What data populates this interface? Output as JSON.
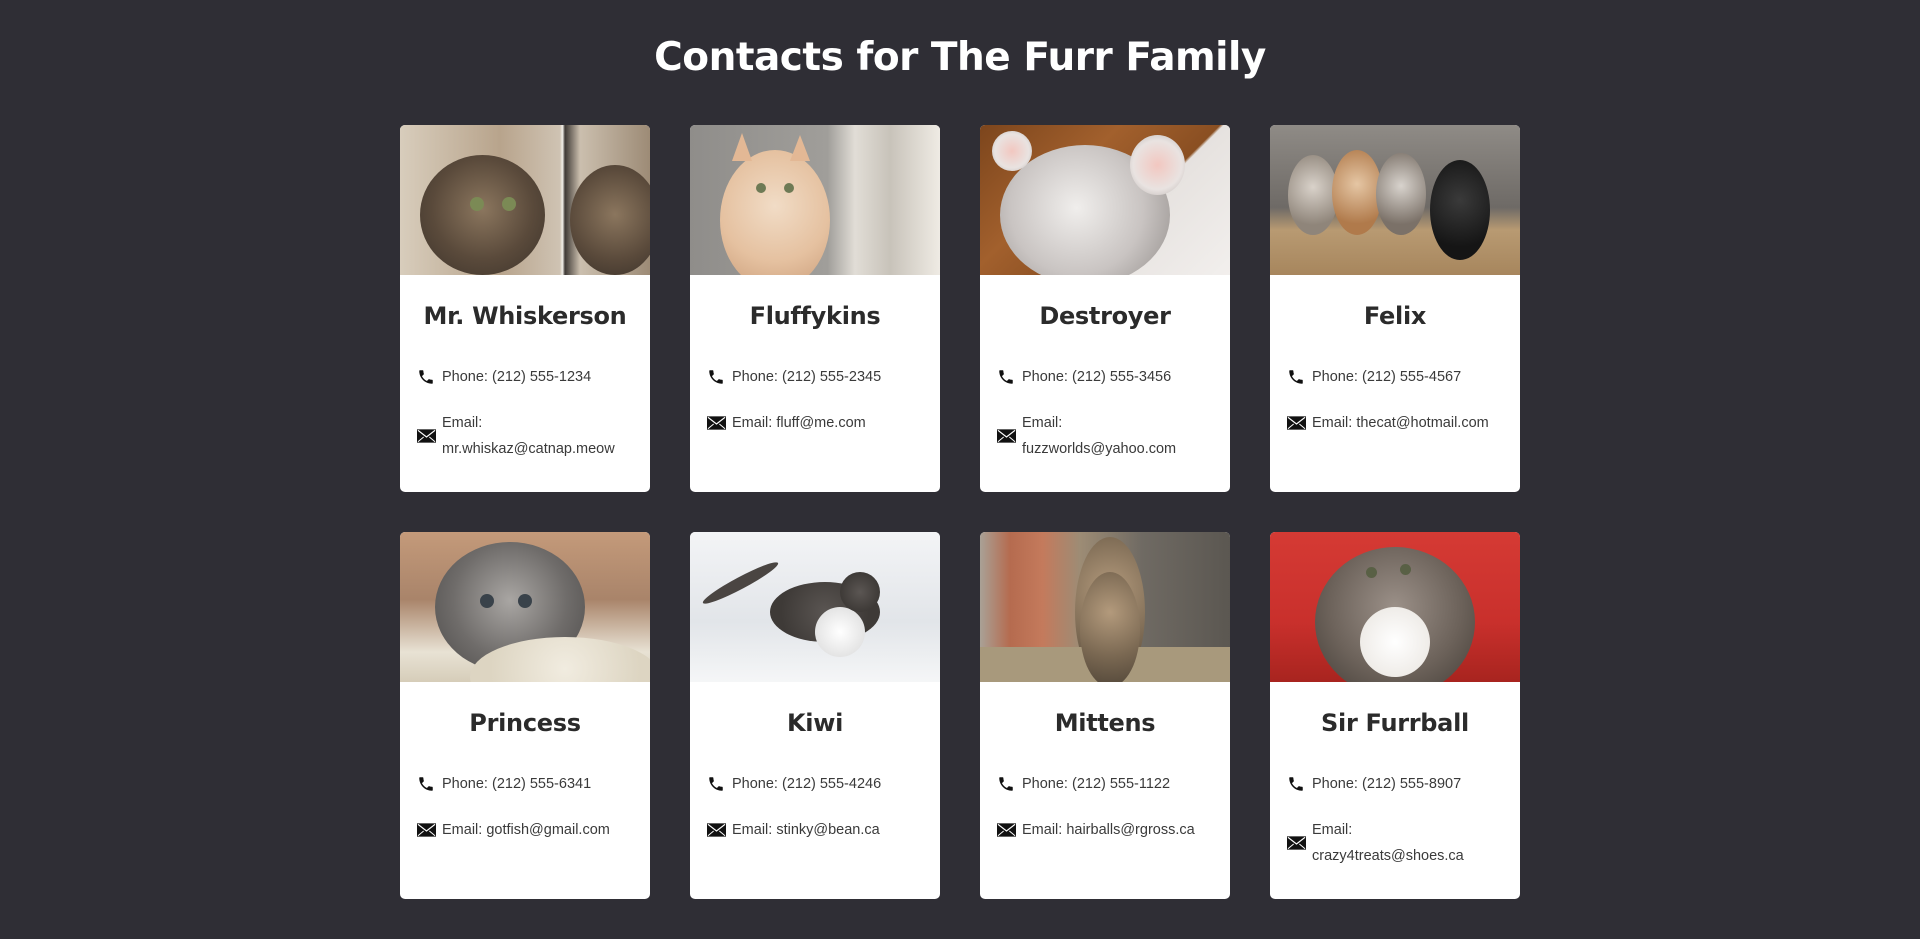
{
  "page": {
    "title": "Contacts for The Furr Family",
    "background": "#2f2e35"
  },
  "icons": {
    "phone": "phone-icon",
    "email": "envelope-icon"
  },
  "contacts": [
    {
      "name": "Mr. Whiskerson",
      "phone_label": "Phone: (212) 555-1234",
      "email_label": "Email:",
      "email": "mr.whiskaz@catnap.meow",
      "photo": "tabby kitten looking at its reflection in a mirror",
      "colors": [
        "#c8b9a6",
        "#6b5a48",
        "#3d342c"
      ]
    },
    {
      "name": "Fluffykins",
      "phone_label": "Phone: (212) 555-2345",
      "email_label": "Email:",
      "email": "fluff@me.com",
      "photo": "cream kitten peeking beside a door frame",
      "colors": [
        "#9a9896",
        "#e2c3a8",
        "#d9d4cc"
      ]
    },
    {
      "name": "Destroyer",
      "phone_label": "Phone: (212) 555-3456",
      "email_label": "Email:",
      "email": "fuzzworlds@yahoo.com",
      "photo": "grey kitten lying on its back with paws up",
      "colors": [
        "#8a4f22",
        "#c9c4c2",
        "#e9e4e2"
      ]
    },
    {
      "name": "Felix",
      "phone_label": "Phone: (212) 555-4567",
      "email_label": "Email:",
      "email": "thecat@hotmail.com",
      "photo": "four kittens sitting in a woven basket",
      "colors": [
        "#6e6a66",
        "#b89a72",
        "#2a2a2a"
      ]
    },
    {
      "name": "Princess",
      "phone_label": "Phone: (212) 555-6341",
      "email_label": "Email:",
      "email": "gotfish@gmail.com",
      "photo": "grey fluffy kitten on a knitted blanket",
      "colors": [
        "#c49a7a",
        "#7d7a78",
        "#e8e2d4"
      ]
    },
    {
      "name": "Kiwi",
      "phone_label": "Phone: (212) 555-4246",
      "email_label": "Email:",
      "email": "stinky@bean.ca",
      "photo": "tabby and white cat walking in snow",
      "colors": [
        "#e9ecef",
        "#4a4542",
        "#f7f8f9"
      ]
    },
    {
      "name": "Mittens",
      "phone_label": "Phone: (212) 555-1122",
      "email_label": "Email:",
      "email": "hairballs@rgross.ca",
      "photo": "tabby kitten sitting beside a flower pot and wall",
      "colors": [
        "#b56b4f",
        "#8a7a63",
        "#5b5751"
      ]
    },
    {
      "name": "Sir Furrball",
      "phone_label": "Phone: (212) 555-8907",
      "email_label": "Email:",
      "email": "crazy4treats@shoes.ca",
      "photo": "long-haired kitten on a red sofa",
      "colors": [
        "#c9302c",
        "#6c625a",
        "#efece8"
      ]
    }
  ]
}
